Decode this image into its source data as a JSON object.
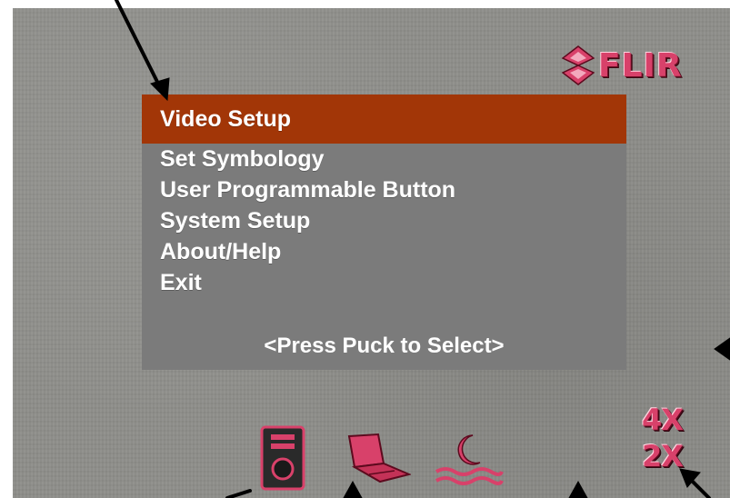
{
  "brand": {
    "logo_text": "FLIR",
    "color": "#d8416a"
  },
  "menu": {
    "items": [
      {
        "label": "Video Setup",
        "selected": true
      },
      {
        "label": "Set Symbology",
        "selected": false
      },
      {
        "label": "User Programmable Button",
        "selected": false
      },
      {
        "label": "System Setup",
        "selected": false
      },
      {
        "label": "About/Help",
        "selected": false
      },
      {
        "label": "Exit",
        "selected": false
      }
    ],
    "hint": "<Press Puck to Select>",
    "highlight_color": "#a23607"
  },
  "status_icons": [
    "joystick-controller-icon",
    "laptop-icon",
    "night-mode-moon-icon"
  ],
  "zoom": {
    "levels": [
      "4X",
      "2X"
    ]
  }
}
